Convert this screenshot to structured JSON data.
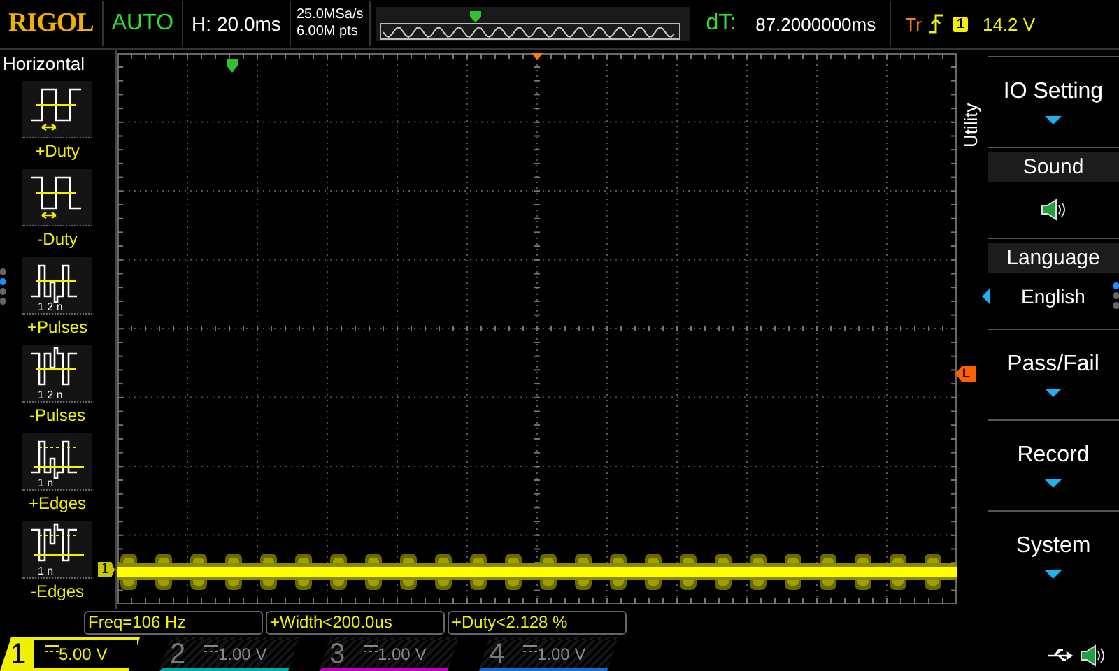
{
  "header": {
    "logo": "RIGOL",
    "run_status": "AUTO",
    "timebase_label": "H:",
    "timebase": "20.0ms",
    "sample_rate": "25.0MSa/s",
    "memory_depth": "6.00M pts",
    "delta_label": "dT:",
    "delta_value": "87.2000000ms",
    "trigger_label": "Tr",
    "trigger_source": "1",
    "trigger_level": "14.2 V"
  },
  "left_menu": {
    "title": "Horizontal",
    "items": [
      {
        "kind": "pos-duty",
        "label": "+Duty"
      },
      {
        "kind": "neg-duty",
        "label": "-Duty"
      },
      {
        "kind": "pos-pulses",
        "label": "+Pulses",
        "caption": "1 2  n"
      },
      {
        "kind": "neg-pulses",
        "label": "-Pulses",
        "caption": "1 2  n"
      },
      {
        "kind": "pos-edges",
        "label": "+Edges",
        "caption": "1    n"
      },
      {
        "kind": "neg-edges",
        "label": "-Edges",
        "caption": "1    n"
      }
    ],
    "page_dots": [
      {
        "selected": false
      },
      {
        "selected": true
      },
      {
        "selected": false
      },
      {
        "selected": false
      }
    ]
  },
  "screen": {
    "channel_marker": "1",
    "trigger_level_marker": "L"
  },
  "right_menu": {
    "title": "Utility",
    "items": [
      {
        "kind": "submenu",
        "label": "IO Setting"
      },
      {
        "kind": "sound",
        "label": "Sound"
      },
      {
        "kind": "choice",
        "label": "Language",
        "value": "English"
      },
      {
        "kind": "submenu",
        "label": "Pass/Fail"
      },
      {
        "kind": "submenu",
        "label": "Record"
      },
      {
        "kind": "submenu",
        "label": "System"
      }
    ],
    "page_dots": [
      {
        "selected": true
      },
      {
        "selected": false
      },
      {
        "selected": false
      }
    ]
  },
  "measurements": [
    "Freq=106 Hz",
    "+Width<200.0us",
    "+Duty<2.128 %"
  ],
  "channels": [
    {
      "number": "1",
      "scale": "5.00 V",
      "on": true,
      "color": "#f0f000"
    },
    {
      "number": "2",
      "scale": "1.00 V",
      "on": false,
      "color": "#00a8a8"
    },
    {
      "number": "3",
      "scale": "1.00 V",
      "on": false,
      "color": "#c000c0"
    },
    {
      "number": "4",
      "scale": "1.00 V",
      "on": false,
      "color": "#1070d0"
    }
  ]
}
